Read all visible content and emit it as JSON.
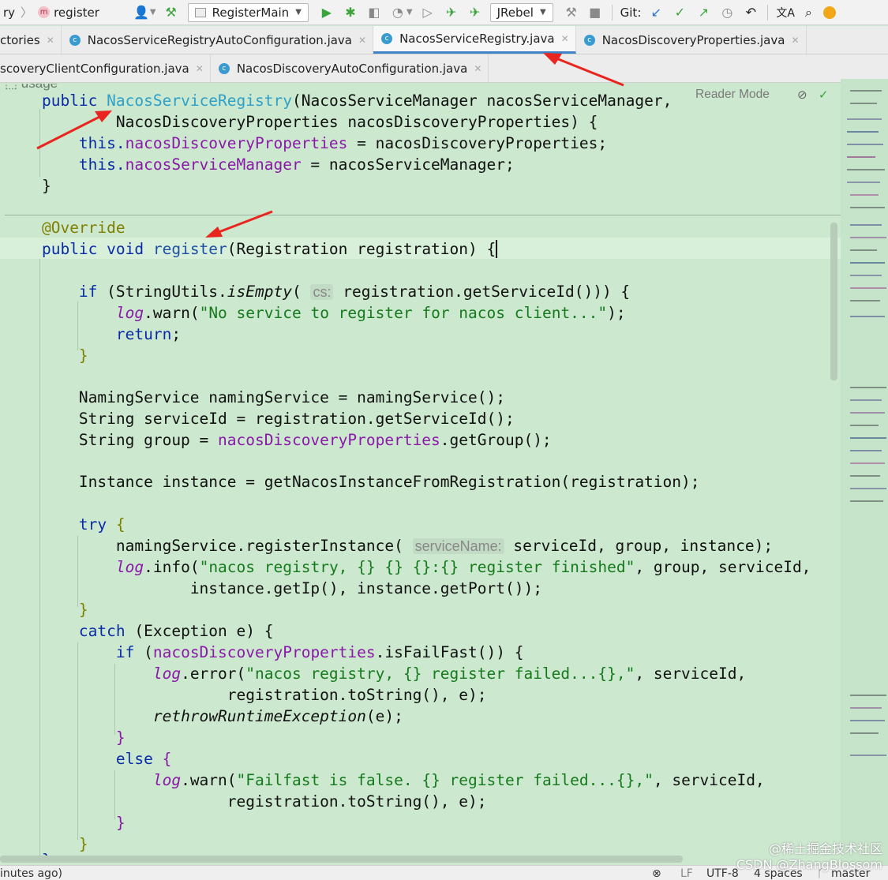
{
  "toolbar": {
    "crumb_prev": "ry",
    "module_badge": "m",
    "module": "register",
    "run_config": "RegisterMain",
    "jrebel": "JRebel",
    "git_label": "Git:"
  },
  "tabs_row1": [
    {
      "label": "ctories",
      "icon": ""
    },
    {
      "label": "NacosServiceRegistryAutoConfiguration.java",
      "icon": "c"
    },
    {
      "label": "NacosServiceRegistry.java",
      "icon": "c",
      "active": true
    },
    {
      "label": "NacosDiscoveryProperties.java",
      "icon": "c"
    }
  ],
  "tabs_row2": [
    {
      "label": "scoveryClientConfiguration.java",
      "icon": ""
    },
    {
      "label": "NacosDiscoveryAutoConfiguration.java",
      "icon": "c"
    }
  ],
  "editor": {
    "reader_mode": "Reader Mode",
    "usage_label": "usage",
    "code": {
      "l1": {
        "kw": "public",
        "name": "NacosServiceRegistry",
        "open": "(",
        "rest": "NacosServiceManager nacosServiceManager,"
      },
      "l2": {
        "text": "NacosDiscoveryProperties nacosDiscoveryProperties) {"
      },
      "l3": {
        "this": "this.",
        "field": "nacosDiscoveryProperties",
        "rest": " = nacosDiscoveryProperties;"
      },
      "l4": {
        "this": "this.",
        "field": "nacosServiceManager",
        "rest": " = nacosServiceManager;"
      },
      "l5": "}",
      "l6": "@Override",
      "l7": {
        "kw": "public void",
        "name": "register",
        "rest": "(Registration registration) {"
      },
      "l8": {
        "kw": "if",
        "a": " (StringUtils.",
        "m": "isEmpty",
        "b": "(",
        "hint": "cs:",
        "c": " registration.getServiceId())) {"
      },
      "l9": {
        "log": "log",
        "a": ".warn(",
        "str": "\"No service to register for nacos client...\"",
        "b": ");"
      },
      "l10": {
        "kw": "return",
        "a": ";"
      },
      "l11": "}",
      "l12": "NamingService namingService = namingService();",
      "l13": "String serviceId = registration.getServiceId();",
      "l14": {
        "a": "String group = ",
        "field": "nacosDiscoveryProperties",
        "b": ".getGroup();"
      },
      "l15": "Instance instance = getNacosInstanceFromRegistration(registration);",
      "l16": {
        "kw": "try",
        "a": " {"
      },
      "l17": {
        "a": "namingService.registerInstance(",
        "hint": "serviceName:",
        "b": " serviceId, group, instance);"
      },
      "l18": {
        "log": "log",
        "a": ".info(",
        "str": "\"nacos registry, {} {} {}:{} register finished\"",
        "b": ", group, serviceId,"
      },
      "l19": "instance.getIp(), instance.getPort());",
      "l20": "}",
      "l21": {
        "kw": "catch",
        "a": " (Exception e) {"
      },
      "l22": {
        "kw": "if",
        "a": " (",
        "field": "nacosDiscoveryProperties",
        "b": ".isFailFast()) {"
      },
      "l23": {
        "log": "log",
        "a": ".error(",
        "str": "\"nacos registry, {} register failed...{},\"",
        "b": ", serviceId,"
      },
      "l24": "registration.toString(), e);",
      "l25": {
        "m": "rethrowRuntimeException",
        "a": "(e);"
      },
      "l26": "}",
      "l27": {
        "kw": "else",
        "a": " {"
      },
      "l28": {
        "log": "log",
        "a": ".warn(",
        "str": "\"Failfast is false. {} register failed...{},\"",
        "b": ", serviceId,"
      },
      "l29": "registration.toString(), e);",
      "l30": "}",
      "l31": "}",
      "l32": "}"
    }
  },
  "status": {
    "vcs_time": "inutes ago)",
    "line_sep": "LF",
    "encoding": "UTF-8",
    "indent": "4 spaces",
    "branch": "master"
  },
  "watermark": {
    "line1": "@稀土掘金技术社区",
    "line2": "CSDN @ZhangBlossom"
  },
  "colors": {
    "editor_bg": "#cce8cf",
    "keyword": "#0a2ba8",
    "field": "#8a18a8",
    "string": "#157a1c",
    "annotation": "#808000",
    "arrow": "#e8261f",
    "active_tab": "#4083c9"
  }
}
